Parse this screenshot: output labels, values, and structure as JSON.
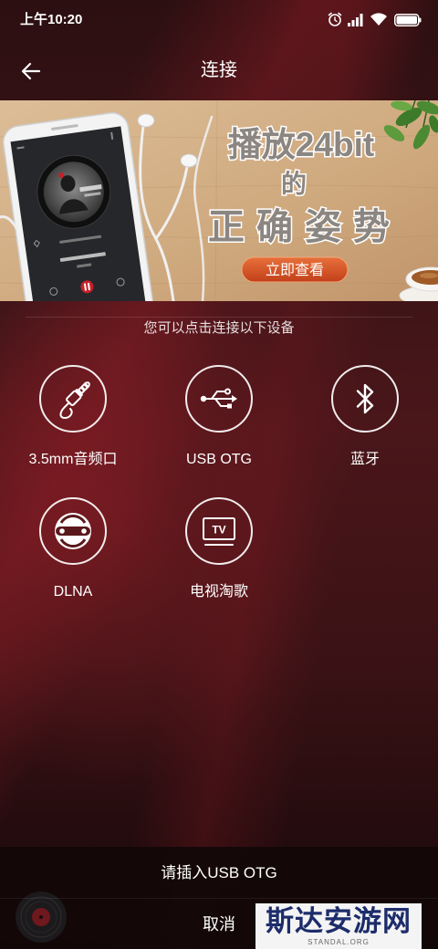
{
  "status_bar": {
    "time": "上午10:20",
    "icons": [
      "alarm-icon",
      "signal-icon",
      "wifi-icon",
      "battery-icon"
    ]
  },
  "header": {
    "back_icon": "back-arrow-icon",
    "title": "连接"
  },
  "banner": {
    "line1": "播放24bit",
    "line2": "的",
    "line3": "正确姿势",
    "button_label": "立即查看"
  },
  "section": {
    "hint": "您可以点击连接以下设备"
  },
  "devices": [
    {
      "label": "3.5mm音频口",
      "icon": "headphone-jack-icon"
    },
    {
      "label": "USB OTG",
      "icon": "usb-icon"
    },
    {
      "label": "蓝牙",
      "icon": "bluetooth-icon"
    },
    {
      "label": "DLNA",
      "icon": "dlna-icon"
    },
    {
      "label": "电视淘歌",
      "icon": "tv-icon",
      "icon_text": "TV"
    }
  ],
  "sheet": {
    "message": "请插入USB OTG",
    "cancel_label": "取消"
  },
  "player": {
    "icon": "vinyl-disc-icon"
  },
  "watermark": {
    "name": "斯达安游网",
    "domain": "STANDAL.ORG"
  },
  "colors": {
    "background": "#3a1417",
    "accent": "#d4531f",
    "text": "#ffffff"
  }
}
